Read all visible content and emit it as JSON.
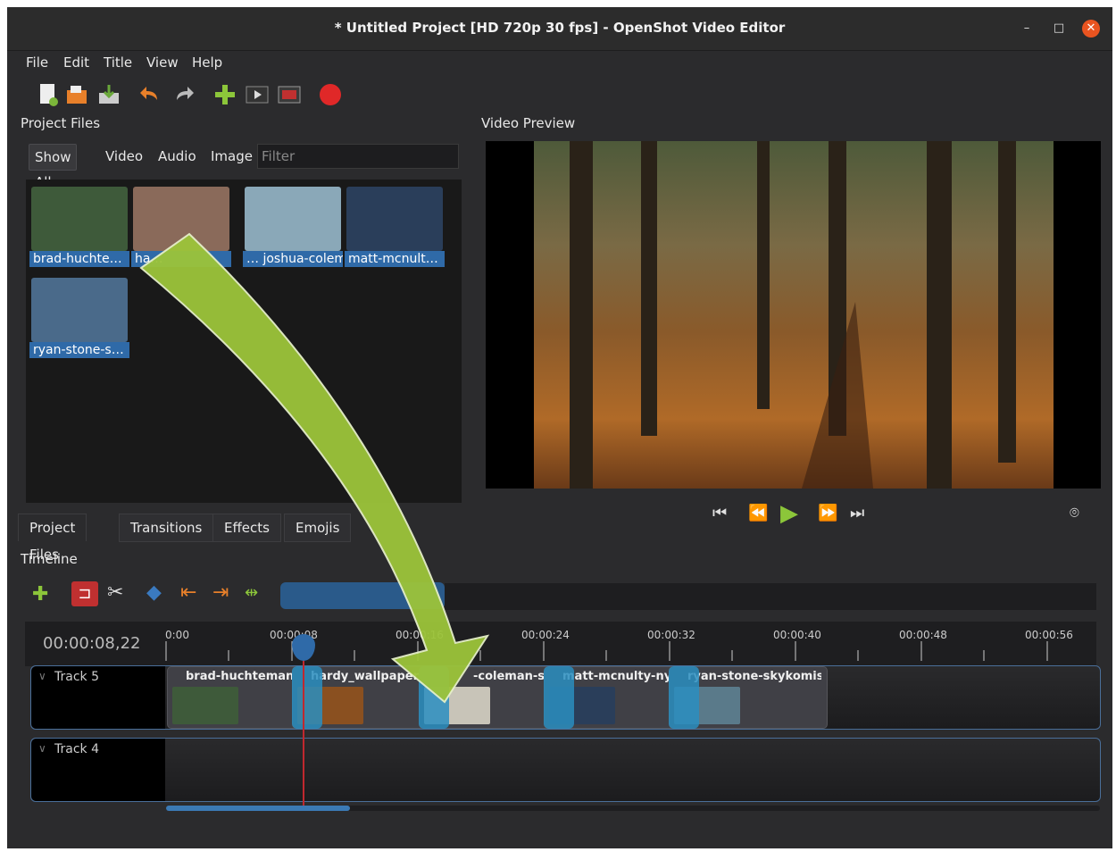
{
  "window": {
    "title": "* Untitled Project [HD 720p 30 fps] - OpenShot Video Editor"
  },
  "menu": [
    "File",
    "Edit",
    "Title",
    "View",
    "Help"
  ],
  "toolbar_icons": [
    "new-project-icon",
    "open-project-icon",
    "save-project-icon",
    "undo-icon",
    "redo-icon",
    "import-files-icon",
    "preview-icon",
    "fullscreen-icon",
    "record-icon"
  ],
  "project_files": {
    "title": "Project Files",
    "filters": [
      "Show All",
      "Video",
      "Audio",
      "Image"
    ],
    "filter_placeholder": "Filter",
    "items": [
      {
        "label": "brad-huchte…",
        "color": "#3e5a3a"
      },
      {
        "label": "ha…",
        "color": "#8a6a5a"
      },
      {
        "label": "… joshua-colem…",
        "color": "#8aa8b8"
      },
      {
        "label": "matt-mcnult…",
        "color": "#2a3e5a"
      },
      {
        "label": "ryan-stone-s…",
        "color": "#4a6a8a"
      }
    ]
  },
  "video_preview": {
    "title": "Video Preview"
  },
  "tabs": [
    "Project Files",
    "Transitions",
    "Effects",
    "Emojis"
  ],
  "timeline": {
    "title": "Timeline",
    "timecode": "00:00:08,22",
    "ticks": [
      "0:00",
      "00:00:08",
      "00:00:16",
      "00:00:24",
      "00:00:32",
      "00:00:40",
      "00:00:48",
      "00:00:56"
    ],
    "tracks": [
      {
        "name": "Track 5",
        "clips": [
          {
            "name": "brad-huchteman-s",
            "color": "#3e5a3a"
          },
          {
            "name": "hardy_wallpaper_",
            "color": "#8a5020"
          },
          {
            "name": "-coleman-sc",
            "color": "#c8c4b8"
          },
          {
            "name": "matt-mcnulty-nyc-",
            "color": "#2a3e5a"
          },
          {
            "name": "ryan-stone-skykomis…",
            "color": "#5a7a8a"
          }
        ]
      },
      {
        "name": "Track 4",
        "clips": []
      }
    ]
  },
  "accent_color": "#2f6aa8",
  "arrow_color": "#9cc43a"
}
